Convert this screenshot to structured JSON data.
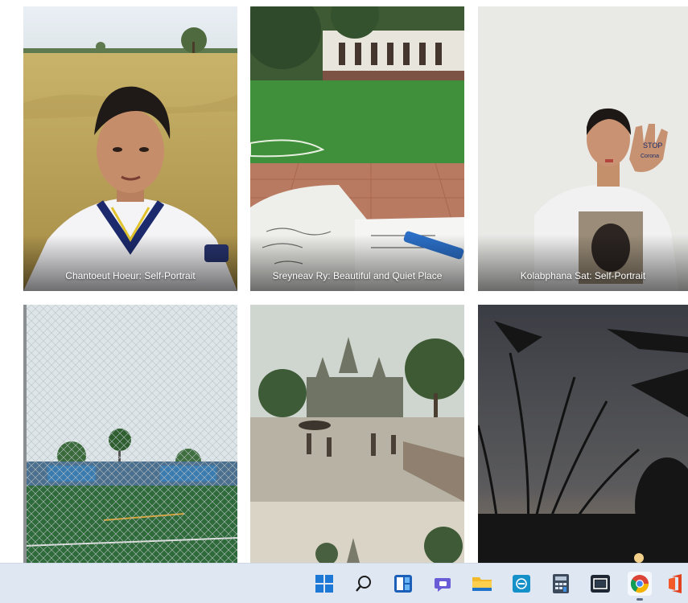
{
  "gallery": {
    "tiles": [
      {
        "caption": "Chantoeut Hoeur: Self-Portrait"
      },
      {
        "caption": "Sreyneav Ry: Beautiful and Quiet Place"
      },
      {
        "caption": "Kolabphana Sat: Self-Portrait"
      },
      {
        "caption": ""
      },
      {
        "caption": ""
      },
      {
        "caption": ""
      }
    ]
  },
  "taskbar": {
    "background": "#dfe7f3",
    "icons": [
      "windows-start-icon",
      "search-icon",
      "widgets-icon",
      "chat-icon",
      "file-explorer-icon",
      "mail-icon",
      "calculator-icon",
      "media-icon",
      "chrome-icon",
      "office-icon"
    ],
    "active": "chrome-icon"
  }
}
